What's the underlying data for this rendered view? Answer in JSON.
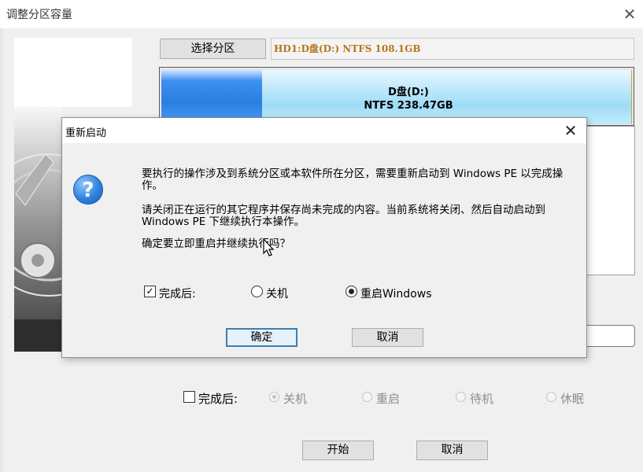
{
  "window": {
    "title": "调整分区容量",
    "close_glyph": "✕"
  },
  "top_controls": {
    "select_partition_label": "选择分区",
    "partition_info": "HD1:D盘(D:) NTFS 108.1GB"
  },
  "partition_bar": {
    "name": "D盘(D:)",
    "fs_size": "NTFS 238.47GB"
  },
  "main_options": {
    "after_label": "完成后:",
    "after_checked": false,
    "radios": [
      {
        "label": "关机",
        "checked": true
      },
      {
        "label": "重启",
        "checked": false
      },
      {
        "label": "待机",
        "checked": false
      },
      {
        "label": "休眠",
        "checked": false
      }
    ],
    "start_label": "开始",
    "cancel_label": "取消"
  },
  "dialog": {
    "title": "重新启动",
    "close_glyph": "✕",
    "icon": "question-icon",
    "message_1": "要执行的操作涉及到系统分区或本软件所在分区，需要重新启动到 Windows PE 以完成操作。",
    "message_2": "请关闭正在运行的其它程序并保存尚未完成的内容。当前系统将关闭、然后自动启动到 Windows PE 下继续执行本操作。",
    "message_3": "确定要立即重启并继续执行吗？",
    "after_label": "完成后:",
    "after_checked": true,
    "radio_shutdown": "关机",
    "radio_restart": "重启Windows",
    "selected": "重启Windows",
    "ok_label": "确定",
    "cancel_label": "取消"
  },
  "colors": {
    "dialog_ok_border": "#3c7fb1",
    "partition_used": "#2a7ee0",
    "partition_free": "#9edcf7",
    "partition_info_text": "#b8741a"
  }
}
